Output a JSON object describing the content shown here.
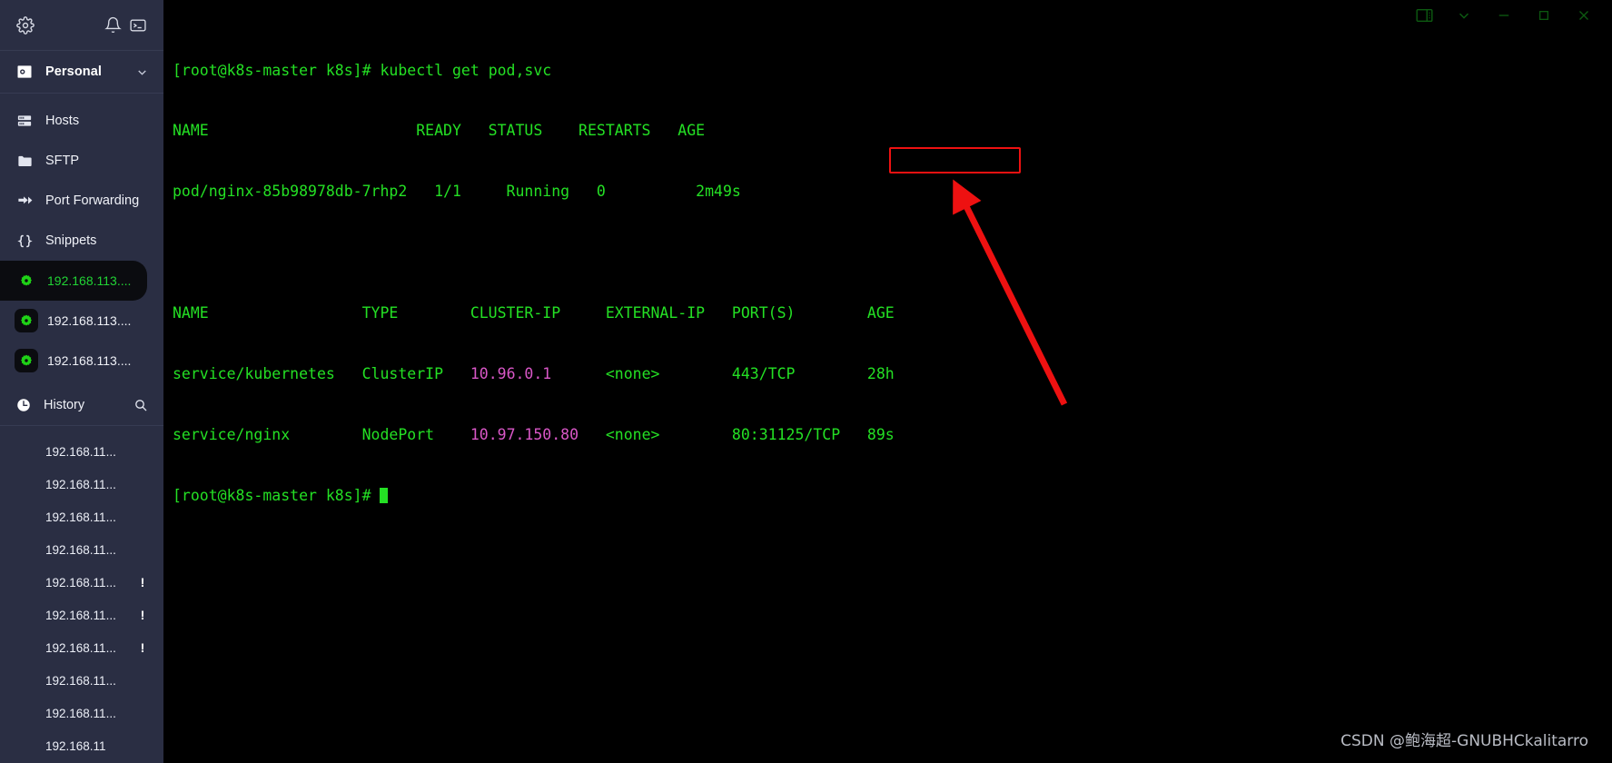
{
  "sidebar": {
    "toolbar": [
      {
        "name": "settings-gear",
        "icon": "gear-icon"
      },
      {
        "name": "notifications",
        "icon": "bell-icon"
      },
      {
        "name": "new-terminal",
        "icon": "terminal-icon"
      }
    ],
    "account": {
      "label": "Personal",
      "icon": "vault-icon",
      "chevron": "chevron-down-icon"
    },
    "nav_items": [
      {
        "label": "Hosts",
        "icon": "hosts-icon"
      },
      {
        "label": "SFTP",
        "icon": "folder-icon"
      },
      {
        "label": "Port Forwarding",
        "icon": "forward-icon"
      },
      {
        "label": "Snippets",
        "icon": "braces-icon"
      }
    ],
    "hosts": [
      {
        "label": "192.168.113....",
        "icon": "gear-host-icon",
        "active": true
      },
      {
        "label": "192.168.113....",
        "icon": "gear-host-icon",
        "active": false
      },
      {
        "label": "192.168.113....",
        "icon": "gear-host-icon",
        "active": false
      }
    ],
    "history": {
      "label": "History",
      "icon": "clock-icon",
      "search_icon": "search-icon",
      "items": [
        {
          "label": "192.168.11...",
          "warn": ""
        },
        {
          "label": "192.168.11...",
          "warn": ""
        },
        {
          "label": "192.168.11...",
          "warn": ""
        },
        {
          "label": "192.168.11...",
          "warn": ""
        },
        {
          "label": "192.168.11...",
          "warn": "!"
        },
        {
          "label": "192.168.11...",
          "warn": "!"
        },
        {
          "label": "192.168.11...",
          "warn": "!"
        },
        {
          "label": "192.168.11...",
          "warn": ""
        },
        {
          "label": "192.168.11...",
          "warn": ""
        },
        {
          "label": "192.168.11",
          "warn": ""
        }
      ]
    }
  },
  "titlebar": {
    "buttons": [
      {
        "name": "split-pane-button",
        "icon": "split-pane-icon"
      },
      {
        "name": "tab-menu-button",
        "icon": "chevron-down-icon"
      },
      {
        "name": "minimize-button",
        "icon": "minimize-icon"
      },
      {
        "name": "maximize-button",
        "icon": "maximize-icon"
      },
      {
        "name": "close-button",
        "icon": "close-icon"
      }
    ]
  },
  "terminal": {
    "prompt": "[root@k8s-master k8s]# ",
    "command": "kubectl get pod,svc",
    "pod_header": "NAME                       READY   STATUS    RESTARTS   AGE",
    "pod_row": "pod/nginx-85b98978db-7rhp2   1/1     Running   0          2m49s",
    "blank": "",
    "svc_header": "NAME                 TYPE        CLUSTER-IP     EXTERNAL-IP   PORT(S)        AGE",
    "svc_row1_pre": "service/kubernetes   ClusterIP   ",
    "svc_row1_ip": "10.96.0.1",
    "svc_row1_post": "      <none>        443/TCP        28h",
    "svc_row2_pre": "service/nginx        NodePort    ",
    "svc_row2_ip": "10.97.150.80",
    "svc_row2_post": "   <none>        80:31125/TCP   89s",
    "final_prompt": "[root@k8s-master k8s]# "
  },
  "annotation": {
    "highlight_target": "80:31125/TCP",
    "arrow_color": "#ee1111",
    "box_color": "#ee1111"
  },
  "watermark": "CSDN @鲍海超-GNUBHCkalitarro"
}
